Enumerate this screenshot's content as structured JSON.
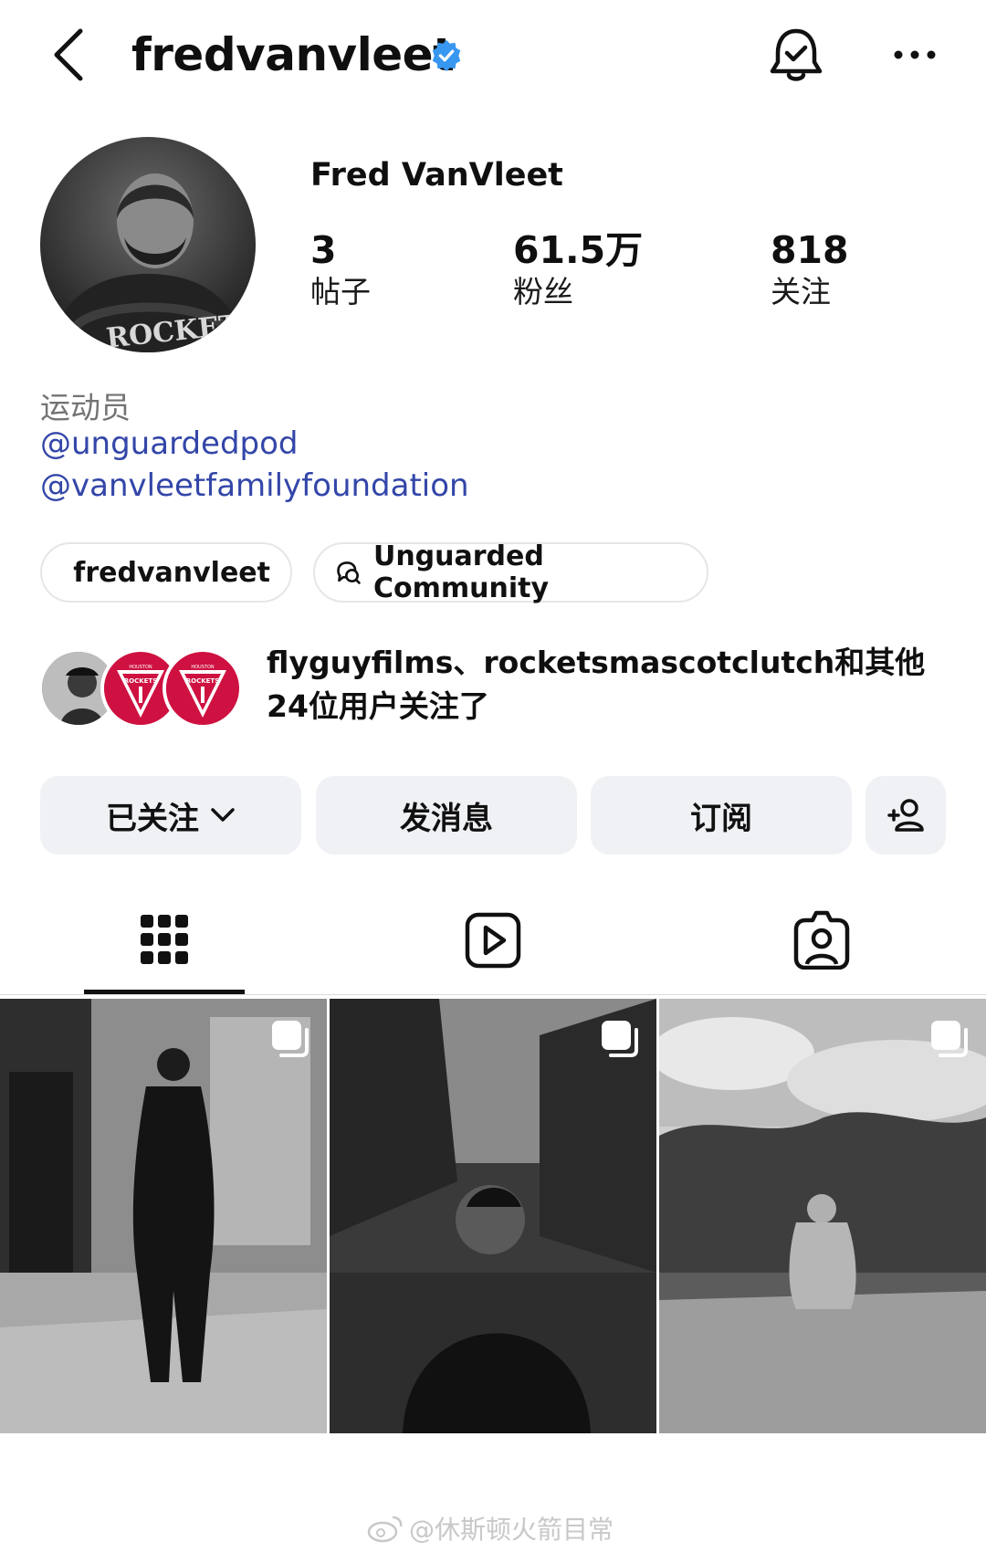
{
  "header": {
    "username": "fredvanvleet",
    "back_icon": "chevron-left-icon",
    "notification_icon": "bell-check-icon",
    "more_icon": "more-horizontal-icon",
    "verified_color": "#3897f0"
  },
  "profile": {
    "display_name": "Fred VanVleet",
    "avatar_text": "ROCKETS",
    "stats": [
      {
        "value": "3",
        "label": "帖子"
      },
      {
        "value": "61.5万",
        "label": "粉丝"
      },
      {
        "value": "818",
        "label": "关注"
      }
    ],
    "category": "运动员",
    "links": [
      "@unguardedpod",
      "@vanvleetfamilyfoundation"
    ]
  },
  "chips": [
    {
      "label": "fredvanvleet",
      "icon": "threads-icon"
    },
    {
      "label": "Unguarded Community",
      "icon": "chat-bubbles-icon"
    }
  ],
  "followed_by": {
    "line1": "flyguyfilms、rocketsmascotclutch和其他",
    "line2": "24位用户关注了",
    "badge_text": "HOUSTON",
    "badge_sub": "ROCKETS"
  },
  "actions": {
    "following_label": "已关注",
    "message_label": "发消息",
    "subscribe_label": "订阅",
    "add_person_icon": "add-person-icon"
  },
  "tabs": [
    "grid-icon",
    "reels-icon",
    "tagged-icon"
  ],
  "watermark": "@休斯顿火箭目常",
  "colors": {
    "link": "#3346a8",
    "button_bg": "#eff1f4",
    "rockets_red": "#ce1141"
  }
}
